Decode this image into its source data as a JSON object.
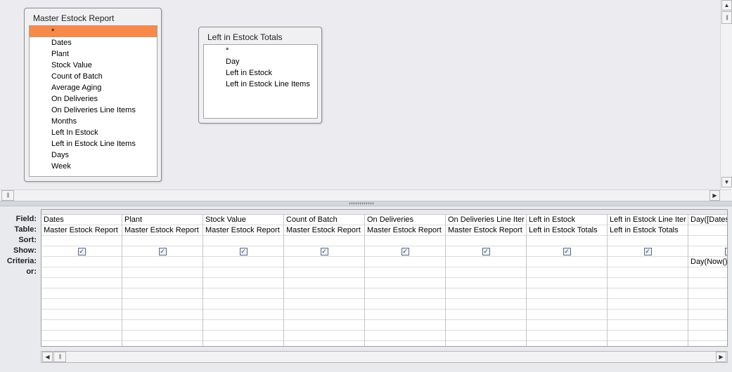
{
  "tables": [
    {
      "title": "Master Estock Report",
      "fields": [
        "*",
        "Dates",
        "Plant",
        "Stock Value",
        "Count of Batch",
        "Average Aging",
        "On Deliveries",
        "On Deliveries Line Items",
        "Months",
        "Left In Estock",
        "Left in Estock Line Items",
        "Days",
        "Week"
      ],
      "selected_index": 0
    },
    {
      "title": "Left in Estock Totals",
      "fields": [
        "*",
        "Day",
        "Left in Estock",
        "Left in Estock Line Items"
      ]
    }
  ],
  "grid": {
    "row_labels": [
      "Field:",
      "Table:",
      "Sort:",
      "Show:",
      "Criteria:",
      "or:"
    ],
    "columns": [
      {
        "field": "Dates",
        "table": "Master Estock Report",
        "sort": "",
        "show": true,
        "criteria": "",
        "or": ""
      },
      {
        "field": "Plant",
        "table": "Master Estock Report",
        "sort": "",
        "show": true,
        "criteria": "",
        "or": ""
      },
      {
        "field": "Stock Value",
        "table": "Master Estock Report",
        "sort": "",
        "show": true,
        "criteria": "",
        "or": ""
      },
      {
        "field": "Count of Batch",
        "table": "Master Estock Report",
        "sort": "",
        "show": true,
        "criteria": "",
        "or": ""
      },
      {
        "field": "On Deliveries",
        "table": "Master Estock Report",
        "sort": "",
        "show": true,
        "criteria": "",
        "or": ""
      },
      {
        "field": "On Deliveries Line Iter",
        "table": "Master Estock Report",
        "sort": "",
        "show": true,
        "criteria": "",
        "or": ""
      },
      {
        "field": "Left in Estock",
        "table": "Left in Estock Totals",
        "sort": "",
        "show": true,
        "criteria": "",
        "or": ""
      },
      {
        "field": "Left in Estock Line Iter",
        "table": "Left in Estock Totals",
        "sort": "",
        "show": true,
        "criteria": "",
        "or": ""
      },
      {
        "field": "Day([Dates",
        "table": "",
        "sort": "",
        "show": false,
        "criteria": "Day(Now()",
        "or": ""
      }
    ]
  },
  "scroll": {
    "up_arrow": "▲",
    "down_arrow": "▼",
    "left_arrow": "◀",
    "right_arrow": "▶",
    "grip": "|||",
    "check_mark": "✓"
  }
}
